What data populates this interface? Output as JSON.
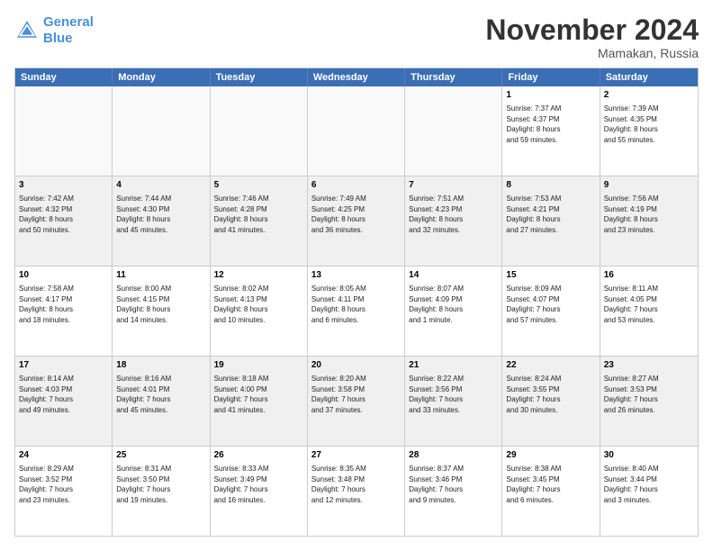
{
  "logo": {
    "line1": "General",
    "line2": "Blue"
  },
  "title": "November 2024",
  "location": "Mamakan, Russia",
  "header_days": [
    "Sunday",
    "Monday",
    "Tuesday",
    "Wednesday",
    "Thursday",
    "Friday",
    "Saturday"
  ],
  "rows": [
    [
      {
        "day": "",
        "text": "",
        "empty": true
      },
      {
        "day": "",
        "text": "",
        "empty": true
      },
      {
        "day": "",
        "text": "",
        "empty": true
      },
      {
        "day": "",
        "text": "",
        "empty": true
      },
      {
        "day": "",
        "text": "",
        "empty": true
      },
      {
        "day": "1",
        "text": "Sunrise: 7:37 AM\nSunset: 4:37 PM\nDaylight: 8 hours\nand 59 minutes.",
        "empty": false
      },
      {
        "day": "2",
        "text": "Sunrise: 7:39 AM\nSunset: 4:35 PM\nDaylight: 8 hours\nand 55 minutes.",
        "empty": false
      }
    ],
    [
      {
        "day": "3",
        "text": "Sunrise: 7:42 AM\nSunset: 4:32 PM\nDaylight: 8 hours\nand 50 minutes.",
        "empty": false
      },
      {
        "day": "4",
        "text": "Sunrise: 7:44 AM\nSunset: 4:30 PM\nDaylight: 8 hours\nand 45 minutes.",
        "empty": false
      },
      {
        "day": "5",
        "text": "Sunrise: 7:46 AM\nSunset: 4:28 PM\nDaylight: 8 hours\nand 41 minutes.",
        "empty": false
      },
      {
        "day": "6",
        "text": "Sunrise: 7:49 AM\nSunset: 4:25 PM\nDaylight: 8 hours\nand 36 minutes.",
        "empty": false
      },
      {
        "day": "7",
        "text": "Sunrise: 7:51 AM\nSunset: 4:23 PM\nDaylight: 8 hours\nand 32 minutes.",
        "empty": false
      },
      {
        "day": "8",
        "text": "Sunrise: 7:53 AM\nSunset: 4:21 PM\nDaylight: 8 hours\nand 27 minutes.",
        "empty": false
      },
      {
        "day": "9",
        "text": "Sunrise: 7:56 AM\nSunset: 4:19 PM\nDaylight: 8 hours\nand 23 minutes.",
        "empty": false
      }
    ],
    [
      {
        "day": "10",
        "text": "Sunrise: 7:58 AM\nSunset: 4:17 PM\nDaylight: 8 hours\nand 18 minutes.",
        "empty": false
      },
      {
        "day": "11",
        "text": "Sunrise: 8:00 AM\nSunset: 4:15 PM\nDaylight: 8 hours\nand 14 minutes.",
        "empty": false
      },
      {
        "day": "12",
        "text": "Sunrise: 8:02 AM\nSunset: 4:13 PM\nDaylight: 8 hours\nand 10 minutes.",
        "empty": false
      },
      {
        "day": "13",
        "text": "Sunrise: 8:05 AM\nSunset: 4:11 PM\nDaylight: 8 hours\nand 6 minutes.",
        "empty": false
      },
      {
        "day": "14",
        "text": "Sunrise: 8:07 AM\nSunset: 4:09 PM\nDaylight: 8 hours\nand 1 minute.",
        "empty": false
      },
      {
        "day": "15",
        "text": "Sunrise: 8:09 AM\nSunset: 4:07 PM\nDaylight: 7 hours\nand 57 minutes.",
        "empty": false
      },
      {
        "day": "16",
        "text": "Sunrise: 8:11 AM\nSunset: 4:05 PM\nDaylight: 7 hours\nand 53 minutes.",
        "empty": false
      }
    ],
    [
      {
        "day": "17",
        "text": "Sunrise: 8:14 AM\nSunset: 4:03 PM\nDaylight: 7 hours\nand 49 minutes.",
        "empty": false
      },
      {
        "day": "18",
        "text": "Sunrise: 8:16 AM\nSunset: 4:01 PM\nDaylight: 7 hours\nand 45 minutes.",
        "empty": false
      },
      {
        "day": "19",
        "text": "Sunrise: 8:18 AM\nSunset: 4:00 PM\nDaylight: 7 hours\nand 41 minutes.",
        "empty": false
      },
      {
        "day": "20",
        "text": "Sunrise: 8:20 AM\nSunset: 3:58 PM\nDaylight: 7 hours\nand 37 minutes.",
        "empty": false
      },
      {
        "day": "21",
        "text": "Sunrise: 8:22 AM\nSunset: 3:56 PM\nDaylight: 7 hours\nand 33 minutes.",
        "empty": false
      },
      {
        "day": "22",
        "text": "Sunrise: 8:24 AM\nSunset: 3:55 PM\nDaylight: 7 hours\nand 30 minutes.",
        "empty": false
      },
      {
        "day": "23",
        "text": "Sunrise: 8:27 AM\nSunset: 3:53 PM\nDaylight: 7 hours\nand 26 minutes.",
        "empty": false
      }
    ],
    [
      {
        "day": "24",
        "text": "Sunrise: 8:29 AM\nSunset: 3:52 PM\nDaylight: 7 hours\nand 23 minutes.",
        "empty": false
      },
      {
        "day": "25",
        "text": "Sunrise: 8:31 AM\nSunset: 3:50 PM\nDaylight: 7 hours\nand 19 minutes.",
        "empty": false
      },
      {
        "day": "26",
        "text": "Sunrise: 8:33 AM\nSunset: 3:49 PM\nDaylight: 7 hours\nand 16 minutes.",
        "empty": false
      },
      {
        "day": "27",
        "text": "Sunrise: 8:35 AM\nSunset: 3:48 PM\nDaylight: 7 hours\nand 12 minutes.",
        "empty": false
      },
      {
        "day": "28",
        "text": "Sunrise: 8:37 AM\nSunset: 3:46 PM\nDaylight: 7 hours\nand 9 minutes.",
        "empty": false
      },
      {
        "day": "29",
        "text": "Sunrise: 8:38 AM\nSunset: 3:45 PM\nDaylight: 7 hours\nand 6 minutes.",
        "empty": false
      },
      {
        "day": "30",
        "text": "Sunrise: 8:40 AM\nSunset: 3:44 PM\nDaylight: 7 hours\nand 3 minutes.",
        "empty": false
      }
    ]
  ]
}
